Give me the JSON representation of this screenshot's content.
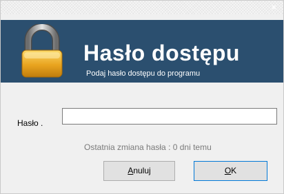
{
  "window": {
    "close_symbol": "×"
  },
  "banner": {
    "title": "Hasło dostępu",
    "subtitle": "Podaj hasło dostępu do programu",
    "icon": "padlock-icon",
    "background_color": "#2b4f6f"
  },
  "form": {
    "password_label": "Hasło .",
    "password_value": "",
    "password_placeholder": "",
    "info_text": "Ostatnia zmiana hasła : 0 dni temu"
  },
  "buttons": {
    "cancel_mnemonic": "A",
    "cancel_rest": "nuluj",
    "ok_mnemonic": "O",
    "ok_rest": "K"
  },
  "colors": {
    "accent": "#0078d7"
  }
}
